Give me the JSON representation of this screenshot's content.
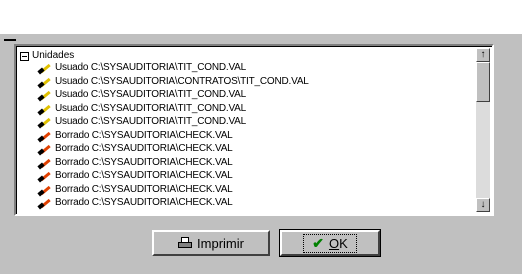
{
  "dialog": {
    "root_label": "Unidades",
    "items": [
      {
        "icon": "pencil-icon",
        "color": "#e0c000",
        "label": "Usuado C:\\SYSAUDITORIA\\TIT_COND.VAL"
      },
      {
        "icon": "pencil-icon",
        "color": "#e0c000",
        "label": "Usuado C:\\SYSAUDITORIA\\CONTRATOS\\TIT_COND.VAL"
      },
      {
        "icon": "pencil-icon",
        "color": "#e0c000",
        "label": "Usuado C:\\SYSAUDITORIA\\TIT_COND.VAL"
      },
      {
        "icon": "pencil-icon",
        "color": "#e0c000",
        "label": "Usuado C:\\SYSAUDITORIA\\TIT_COND.VAL"
      },
      {
        "icon": "pencil-icon",
        "color": "#e0c000",
        "label": "Usuado C:\\SYSAUDITORIA\\TIT_COND.VAL"
      },
      {
        "icon": "pencil-icon",
        "color": "#e04000",
        "label": "Borrado C:\\SYSAUDITORIA\\CHECK.VAL"
      },
      {
        "icon": "pencil-icon",
        "color": "#e04000",
        "label": "Borrado C:\\SYSAUDITORIA\\CHECK.VAL"
      },
      {
        "icon": "pencil-icon",
        "color": "#e04000",
        "label": "Borrado C:\\SYSAUDITORIA\\CHECK.VAL"
      },
      {
        "icon": "pencil-icon",
        "color": "#e04000",
        "label": "Borrado C:\\SYSAUDITORIA\\CHECK.VAL"
      },
      {
        "icon": "pencil-icon",
        "color": "#e04000",
        "label": "Borrado C:\\SYSAUDITORIA\\CHECK.VAL"
      },
      {
        "icon": "pencil-icon",
        "color": "#e04000",
        "label": "Borrado C:\\SYSAUDITORIA\\CHECK.VAL"
      }
    ],
    "scroll_up": "↑",
    "scroll_down": "↓",
    "print_label": "Imprimir",
    "ok_label": "OK"
  }
}
